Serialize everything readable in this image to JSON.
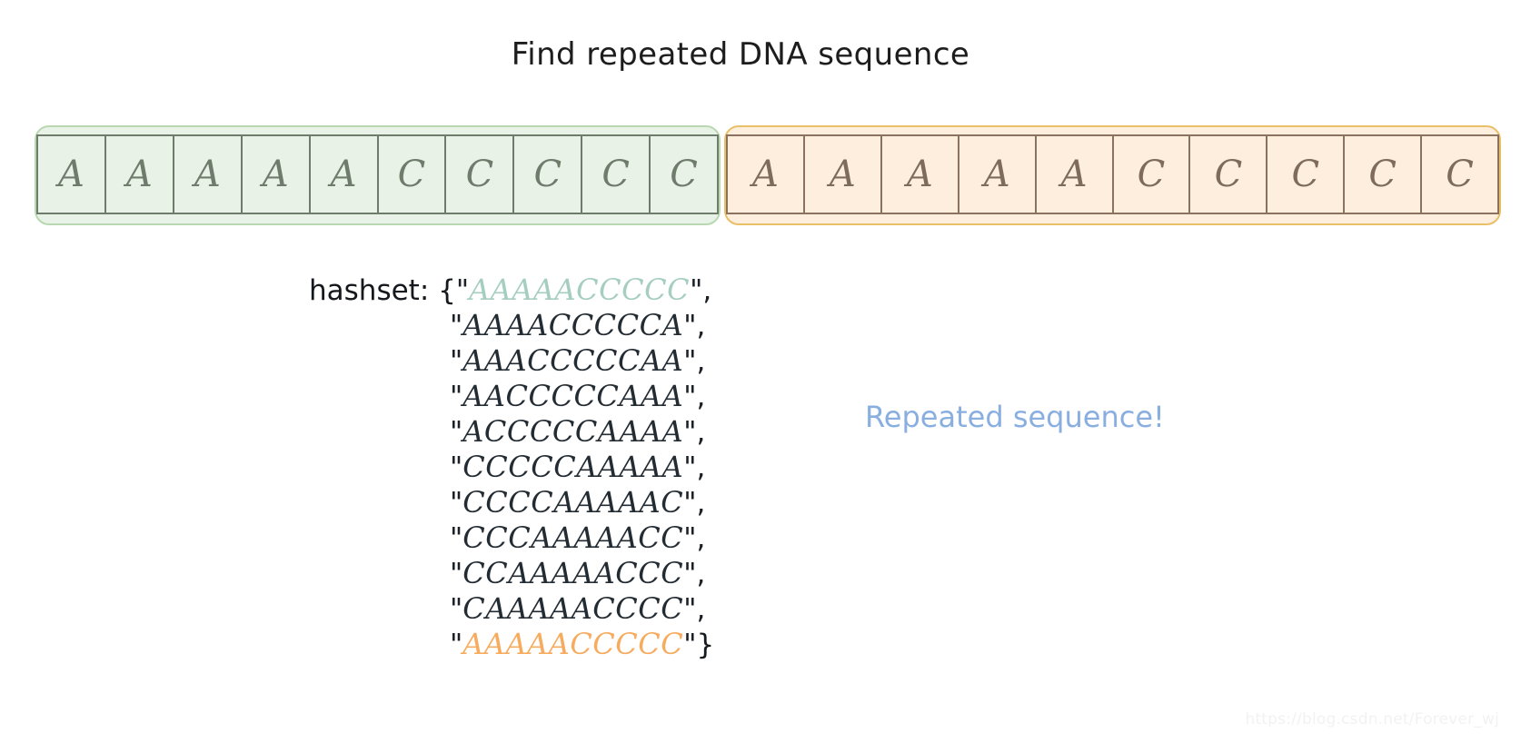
{
  "title": "Find repeated DNA sequence",
  "colors": {
    "green_fill": "#e9f2e7",
    "green_outer_border": "#b9d8b2",
    "green_cell_border": "#6e7c6c",
    "green_letter": "#6e7c6c",
    "orange_fill": "#fdeede",
    "orange_outer_border": "#e9bf68",
    "orange_cell_border": "#8a7160",
    "orange_letter": "#7e6b5c",
    "teal_text": "#a6cec0",
    "orange_text": "#f7ab5e",
    "note_blue": "#89aee0"
  },
  "strip": {
    "groups": [
      {
        "name": "green-window",
        "accent": "green",
        "letters": [
          "A",
          "A",
          "A",
          "A",
          "A",
          "C",
          "C",
          "C",
          "C",
          "C"
        ]
      },
      {
        "name": "orange-window",
        "accent": "orange",
        "letters": [
          "A",
          "A",
          "A",
          "A",
          "A",
          "C",
          "C",
          "C",
          "C",
          "C"
        ]
      }
    ]
  },
  "hashset": {
    "label": "hashset: {",
    "open_quote": "\"",
    "close_quote": "\"",
    "comma": ",",
    "closing_brace": "}",
    "entries": [
      {
        "value": "AAAAACCCCC",
        "color": "teal",
        "trailing": ","
      },
      {
        "value": "AAAACCCCCA",
        "color": "dark",
        "trailing": ","
      },
      {
        "value": "AAACCCCCAA",
        "color": "dark",
        "trailing": ","
      },
      {
        "value": "AACCCCCAAA",
        "color": "dark",
        "trailing": ","
      },
      {
        "value": "ACCCCCAAAA",
        "color": "dark",
        "trailing": ","
      },
      {
        "value": "CCCCCAAAAA",
        "color": "dark",
        "trailing": ","
      },
      {
        "value": "CCCCAAAAAC",
        "color": "dark",
        "trailing": ","
      },
      {
        "value": "CCCAAAAACC",
        "color": "dark",
        "trailing": ","
      },
      {
        "value": "CCAAAAACCC",
        "color": "dark",
        "trailing": ","
      },
      {
        "value": "CAAAAACCCC",
        "color": "dark",
        "trailing": ","
      },
      {
        "value": "AAAAACCCCC",
        "color": "orange",
        "trailing": "}"
      }
    ]
  },
  "annotation": {
    "repeated_note": "Repeated sequence!"
  },
  "watermark": "https://blog.csdn.net/Forever_wj"
}
